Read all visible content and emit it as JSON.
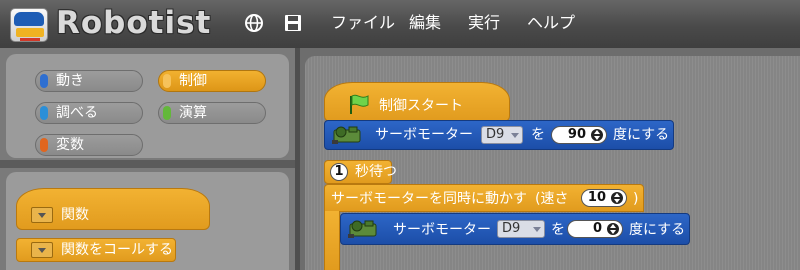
{
  "app": {
    "logo_text": "Robotist"
  },
  "menu": [
    "ファイル",
    "編集",
    "実行",
    "ヘルプ"
  ],
  "categories": [
    {
      "label": "動き",
      "color": "#2f6fd0",
      "selected": false
    },
    {
      "label": "制御",
      "color": "#f0a21f",
      "selected": true
    },
    {
      "label": "調べる",
      "color": "#2b8fd8",
      "selected": false
    },
    {
      "label": "演算",
      "color": "#63b83a",
      "selected": false
    },
    {
      "label": "変数",
      "color": "#e0661f",
      "selected": false
    }
  ],
  "palette_blocks": {
    "function_def": "関数",
    "function_call": "関数をコールする"
  },
  "script": {
    "start": "制御スタート",
    "servo1": {
      "label": "サーボモーター",
      "port": "D9",
      "particle": "を",
      "value": "90",
      "suffix": "度にする"
    },
    "wait": {
      "value": "1",
      "label": "秒待つ"
    },
    "sync": {
      "label": "サーボモーターを同時に動かす",
      "speed_label": "(速さ",
      "speed_value": "10",
      "close": ")"
    },
    "servo2": {
      "label": "サーボモーター",
      "port": "D9",
      "particle": "を",
      "value": "0",
      "suffix": "度にする"
    }
  }
}
